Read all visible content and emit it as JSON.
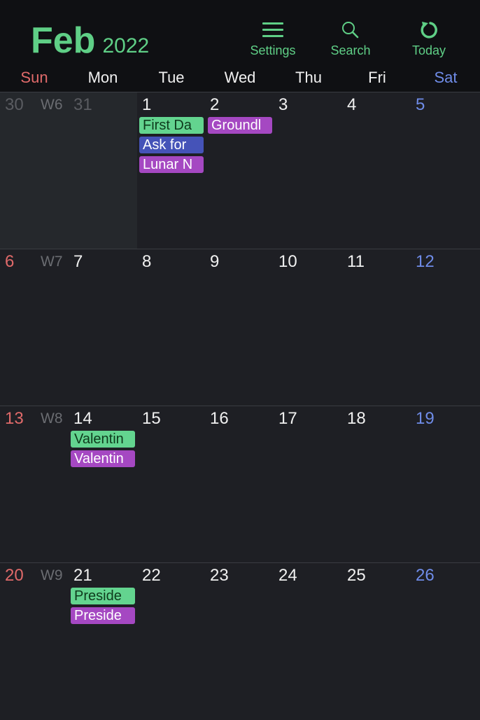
{
  "header": {
    "month": "Feb",
    "year": "2022",
    "tools": [
      {
        "label": "Settings",
        "icon": "menu-icon"
      },
      {
        "label": "Search",
        "icon": "search-icon"
      },
      {
        "label": "Today",
        "icon": "refresh-icon"
      }
    ]
  },
  "weekdays": [
    "Sun",
    "Mon",
    "Tue",
    "Wed",
    "Thu",
    "Fri",
    "Sat"
  ],
  "colors": {
    "accent": "#5fcf86",
    "sunday": "#e06a6a",
    "saturday": "#6f8ce8",
    "event_green": "#63d48f",
    "event_blue": "#4553b8",
    "event_purple": "#a548c2"
  },
  "weeks": [
    {
      "week_label": "W6",
      "days": [
        "30",
        "31",
        "1",
        "2",
        "3",
        "4",
        "5"
      ],
      "events": [
        {
          "day_index": 2,
          "row": 0,
          "color": "green",
          "label": "First Da"
        },
        {
          "day_index": 2,
          "row": 1,
          "color": "blue",
          "label": "Ask for"
        },
        {
          "day_index": 2,
          "row": 2,
          "color": "purple",
          "label": "Lunar N"
        },
        {
          "day_index": 3,
          "row": 0,
          "color": "purple",
          "label": "Groundl"
        }
      ]
    },
    {
      "week_label": "W7",
      "days": [
        "6",
        "7",
        "8",
        "9",
        "10",
        "11",
        "12"
      ],
      "events": []
    },
    {
      "week_label": "W8",
      "days": [
        "13",
        "14",
        "15",
        "16",
        "17",
        "18",
        "19"
      ],
      "events": [
        {
          "day_index": 1,
          "row": 0,
          "color": "green",
          "label": "Valentin"
        },
        {
          "day_index": 1,
          "row": 1,
          "color": "purple",
          "label": "Valentin"
        }
      ]
    },
    {
      "week_label": "W9",
      "days": [
        "20",
        "21",
        "22",
        "23",
        "24",
        "25",
        "26"
      ],
      "events": [
        {
          "day_index": 1,
          "row": 0,
          "color": "green",
          "label": "Preside"
        },
        {
          "day_index": 1,
          "row": 1,
          "color": "purple",
          "label": "Preside"
        }
      ]
    }
  ]
}
